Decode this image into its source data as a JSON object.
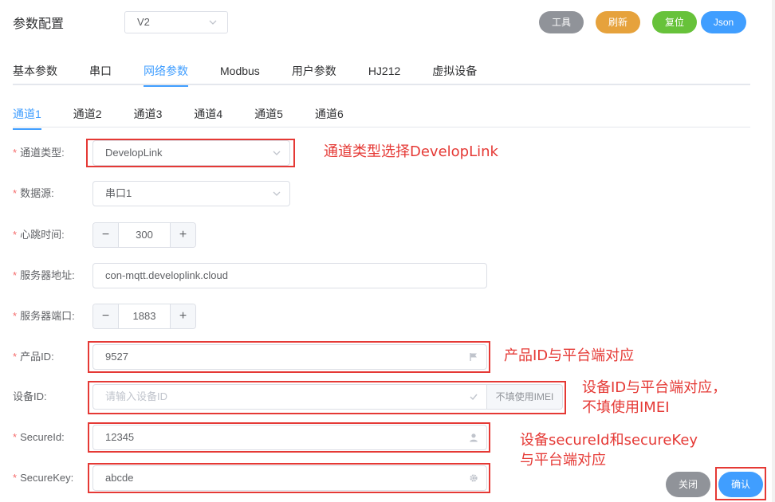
{
  "header": {
    "title": "参数配置",
    "version": "V2",
    "buttons": {
      "tools": "工具",
      "refresh": "刷新",
      "reset": "复位",
      "json": "Json"
    }
  },
  "top_tabs": [
    "基本参数",
    "串口",
    "网络参数",
    "Modbus",
    "用户参数",
    "HJ212",
    "虚拟设备"
  ],
  "top_tabs_active": "网络参数",
  "channel_tabs": [
    "通道1",
    "通道2",
    "通道3",
    "通道4",
    "通道5",
    "通道6"
  ],
  "channel_tabs_active": "通道1",
  "form": {
    "channel_type": {
      "label": "通道类型:",
      "value": "DevelopLink",
      "required": true
    },
    "data_source": {
      "label": "数据源:",
      "value": "串口1",
      "required": true
    },
    "heartbeat": {
      "label": "心跳时间:",
      "value": "300",
      "required": true
    },
    "server_address": {
      "label": "服务器地址:",
      "value": "con-mqtt.developlink.cloud",
      "required": true
    },
    "server_port": {
      "label": "服务器端口:",
      "value": "1883",
      "required": true
    },
    "product_id": {
      "label": "产品ID:",
      "value": "9527",
      "required": true
    },
    "device_id": {
      "label": "设备ID:",
      "value": "",
      "placeholder": "请输入设备ID",
      "required": false,
      "append": "不填使用IMEI"
    },
    "secure_id": {
      "label": "SecureId:",
      "value": "12345",
      "required": true
    },
    "secure_key": {
      "label": "SecureKey:",
      "value": "abcde",
      "required": true
    }
  },
  "annotations": {
    "channel_type": "通道类型选择DevelopLink",
    "product_id": "产品ID与平台端对应",
    "device_id_line1": "设备ID与平台端对应，",
    "device_id_line2": "不填使用IMEI",
    "secure_line1": "设备secureId和secureKey",
    "secure_line2": "与平台端对应"
  },
  "footer": {
    "close": "关闭",
    "confirm": "确认"
  },
  "colors": {
    "primary": "#409eff",
    "warning": "#e6a23c",
    "success": "#67c23a",
    "info": "#909399",
    "annotation_red": "#e53935"
  }
}
